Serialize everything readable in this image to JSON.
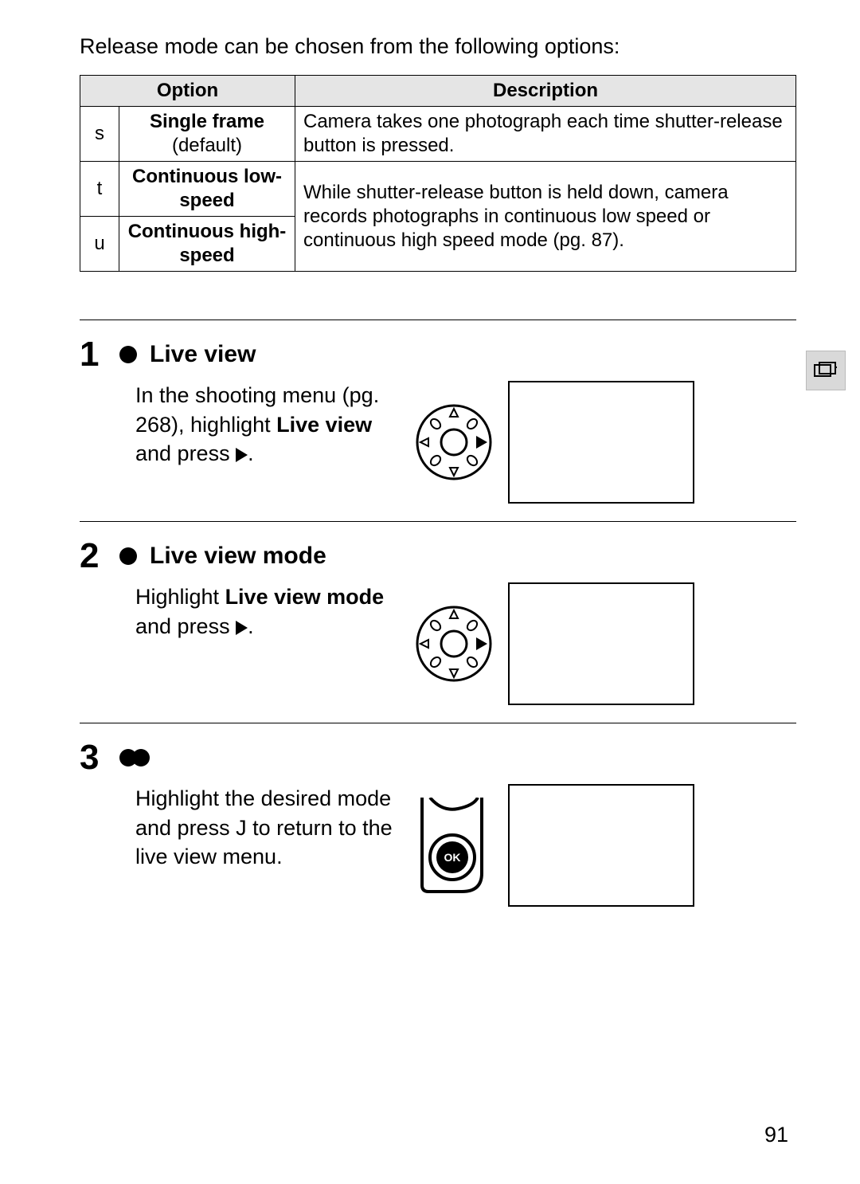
{
  "intro": "Release mode can be chosen from the following options:",
  "table": {
    "headers": {
      "option": "Option",
      "description": "Description"
    },
    "rows": [
      {
        "sym": "s",
        "name": "Single frame",
        "note": "(default)",
        "desc": "Camera takes one photograph each time shutter-release button is pressed."
      },
      {
        "sym": "t",
        "name": "Continuous low-speed",
        "desc": "While shutter-release button is held down, camera records photographs in continuous low speed or continuous high speed mode (pg. 87)."
      },
      {
        "sym": "u",
        "name": "Continuous high-speed"
      }
    ]
  },
  "steps": [
    {
      "num": "1",
      "title": "Live view",
      "text_before": "In the shooting menu (pg. 268), highlight ",
      "bold": "Live view",
      "text_after": " and press ",
      "icon": "multiselector-right"
    },
    {
      "num": "2",
      "title": "Live view mode",
      "text_before": "Highlight ",
      "bold": "Live view mode",
      "text_after": " and press ",
      "icon": "multiselector-right"
    },
    {
      "num": "3",
      "title": "",
      "text_before": "Highlight the desired mode and press ",
      "bold": "J",
      "text_after": " to return to the live view menu.",
      "icon": "ok-button"
    }
  ],
  "page_number": "91"
}
